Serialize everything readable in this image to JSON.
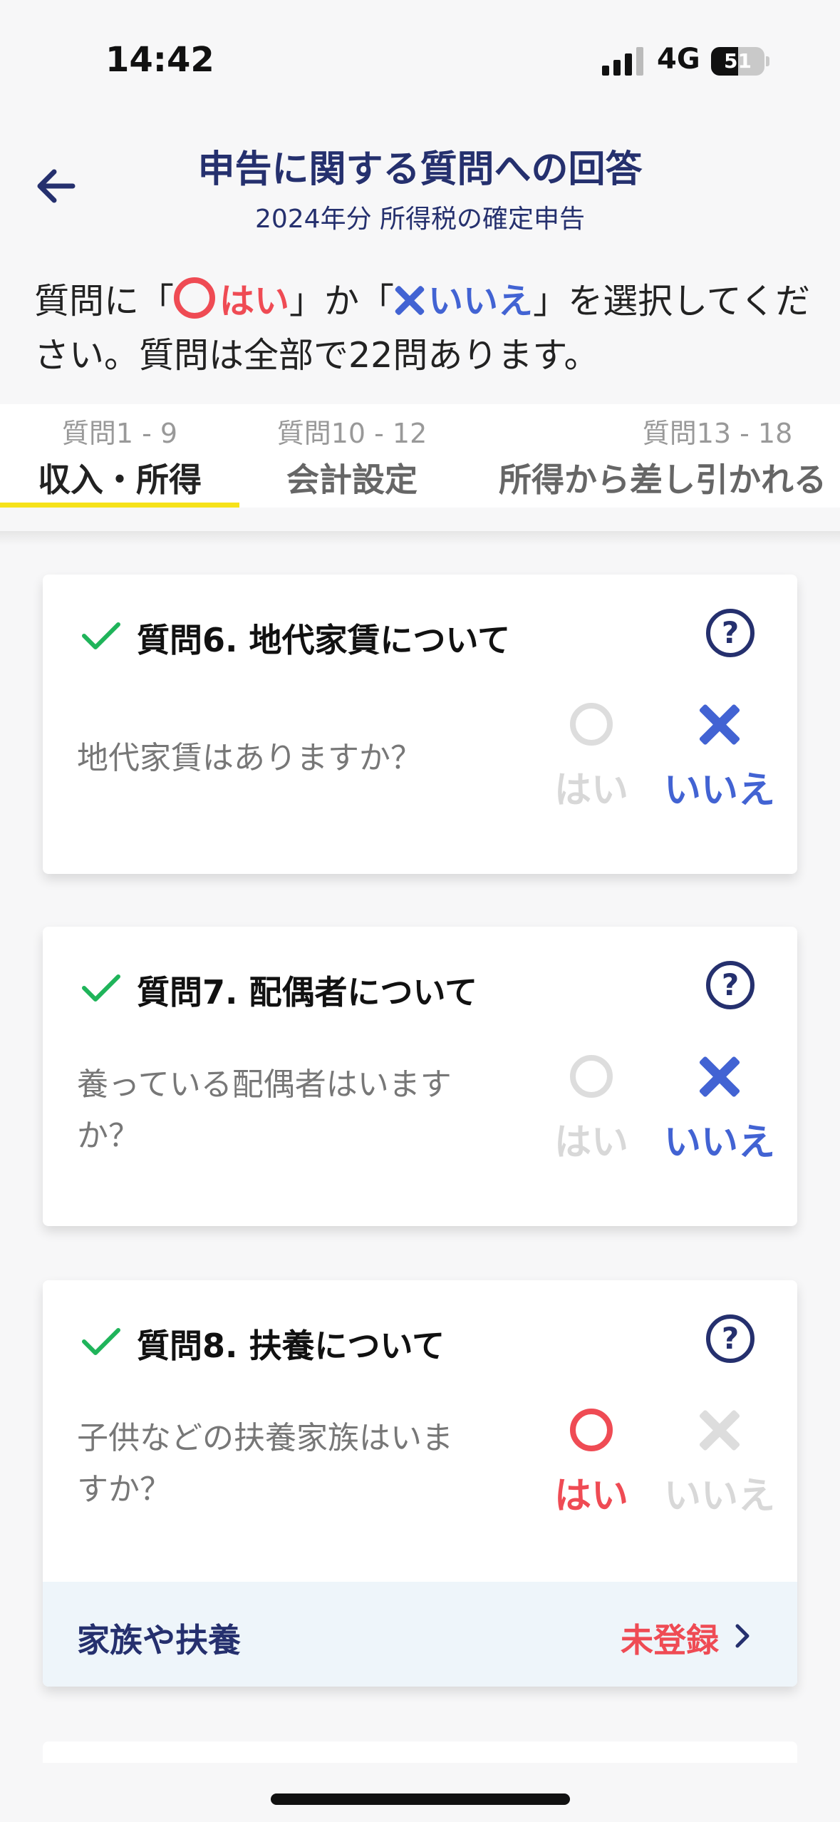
{
  "status_bar": {
    "time": "14:42",
    "network": "4G",
    "battery": "51",
    "battery_level": 51
  },
  "header": {
    "title": "申告に関する質問への回答",
    "subtitle": "2024年分 所得税の確定申告"
  },
  "instruction": {
    "part1": "質問に「",
    "yes": "はい",
    "part2": "」か「",
    "no": "いいえ",
    "part3": "」を選択してください。質問は全部で22問あります。"
  },
  "tabs": [
    {
      "range": "質問1 - 9",
      "label": "収入・所得",
      "active": true
    },
    {
      "range": "質問10 - 12",
      "label": "会計設定",
      "active": false
    },
    {
      "range": "質問13 - 18",
      "label": "所得から差し引かれる",
      "active": false
    }
  ],
  "answer_labels": {
    "yes": "はい",
    "no": "いいえ"
  },
  "questions": [
    {
      "title": "質問6. 地代家賃について",
      "question": "地代家賃はありますか？",
      "answer": "no"
    },
    {
      "title": "質問7. 配偶者について",
      "question": "養っている配偶者はいますか？",
      "answer": "no"
    },
    {
      "title": "質問8. 扶養について",
      "question": "子供などの扶養家族はいますか？",
      "answer": "yes",
      "link": {
        "label": "家族や扶養",
        "status": "未登録"
      }
    }
  ],
  "colors": {
    "navy": "#25306e",
    "yes_red": "#ef4b54",
    "no_blue": "#4263d3",
    "tab_underline": "#f6e21a",
    "check_green": "#1fb45a"
  }
}
